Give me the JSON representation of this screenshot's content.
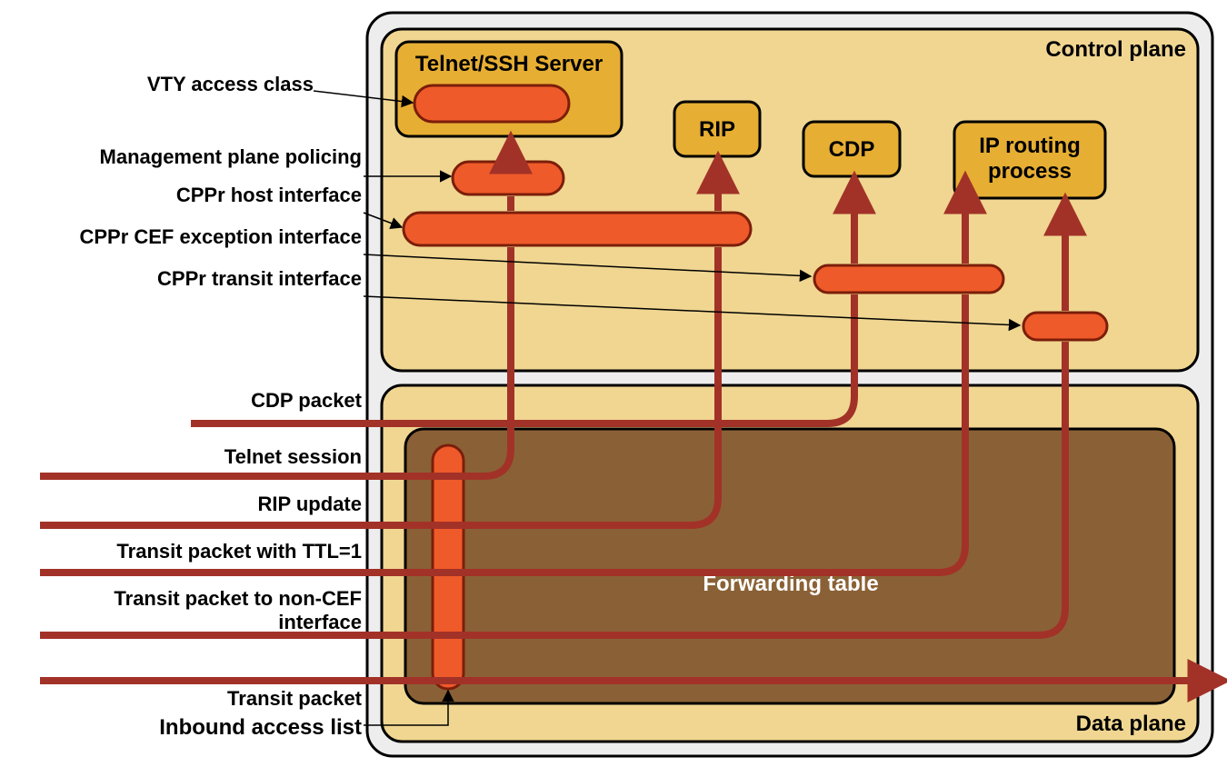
{
  "labels": {
    "vty": "VTY access class",
    "mpp": "Management plane policing",
    "cppr_host": "CPPr  host interface",
    "cppr_cefex": "CPPr CEF exception interface",
    "cppr_transit": "CPPr transit interface",
    "cdp_packet": "CDP packet",
    "telnet_session": "Telnet session",
    "rip_update": "RIP update",
    "ttl1": "Transit packet with TTL=1",
    "noncef_a": "Transit packet to non-CEF",
    "noncef_b": "interface",
    "transit_packet": "Transit packet",
    "inbound_acl": "Inbound access list"
  },
  "planes": {
    "control": "Control plane",
    "data": "Data plane"
  },
  "boxes": {
    "telnet_ssh": "Telnet/SSH Server",
    "rip": "RIP",
    "cdp": "CDP",
    "iprp_a": "IP routing",
    "iprp_b": "process",
    "fwd": "Forwarding table"
  }
}
